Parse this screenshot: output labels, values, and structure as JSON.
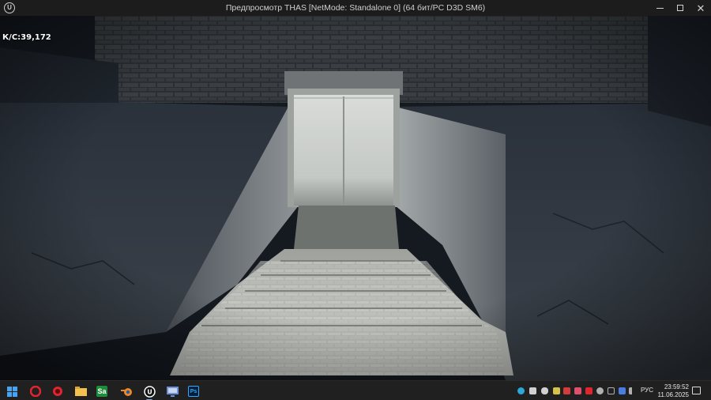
{
  "window": {
    "title": "Предпросмотр THAS [NetMode: Standalone 0]  (64 бит/PC D3D SM6)",
    "app_icon": "unreal-engine-icon",
    "controls": [
      "minimize-icon",
      "maximize-icon",
      "close-icon"
    ]
  },
  "viewport": {
    "fps_label": "К/С:39,172",
    "scene": "underground-stairs-to-metal-door"
  },
  "taskbar": {
    "apps": [
      {
        "name": "windows-start-icon",
        "color": "#4aa3f0"
      },
      {
        "name": "opera-browser-icon",
        "color": "#e0252f"
      },
      {
        "name": "red-circle-app-icon",
        "color": "#e0252f"
      },
      {
        "name": "file-explorer-icon",
        "color": "#f2c14e"
      },
      {
        "name": "substance-painter-icon",
        "color": "#1e8c3a",
        "label": "Sa"
      },
      {
        "name": "blender-icon",
        "color": "#f08a24"
      },
      {
        "name": "unreal-engine-icon",
        "color": "#ffffff"
      },
      {
        "name": "monitor-app-icon",
        "color": "#6f8fd8"
      },
      {
        "name": "photoshop-icon",
        "color": "#31a8ff",
        "label": "Ps"
      }
    ],
    "tray": [
      {
        "name": "tray-app-icon-1",
        "color": "#2aa8d8"
      },
      {
        "name": "tray-app-icon-2",
        "color": "#d0d0d0"
      },
      {
        "name": "tray-app-icon-3",
        "color": "#d0d0d0"
      },
      {
        "name": "tray-app-icon-4",
        "color": "#d4c24a"
      },
      {
        "name": "tray-app-icon-5",
        "color": "#d23c3c"
      },
      {
        "name": "tray-app-icon-6",
        "color": "#e0506e"
      },
      {
        "name": "tray-app-icon-7",
        "color": "#e0252f"
      },
      {
        "name": "tray-app-icon-8",
        "color": "#b0b0b0"
      },
      {
        "name": "tray-app-icon-9",
        "color": "#b0b0b0"
      },
      {
        "name": "tray-app-icon-10",
        "color": "#4a7de0"
      },
      {
        "name": "volume-icon",
        "color": "#b0b0b0"
      }
    ],
    "language": "РУС",
    "time": "23:59:52",
    "date": "11.06.2025"
  }
}
